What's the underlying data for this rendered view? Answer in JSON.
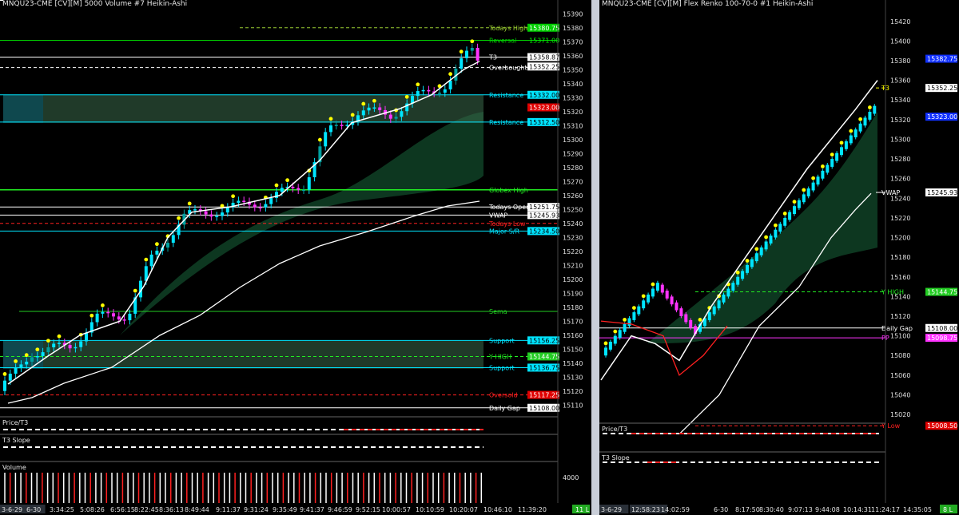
{
  "left": {
    "title": "MNQU23-CME [CV][M]  5000 Volume #7 Heikin-Ashi",
    "yticks": [
      15390,
      15380,
      15370,
      15360,
      15350,
      15340,
      15330,
      15320,
      15310,
      15300,
      15290,
      15280,
      15270,
      15260,
      15250,
      15240,
      15230,
      15220,
      15210,
      15200,
      15190,
      15180,
      15170,
      15160,
      15150,
      15140,
      15130,
      15120,
      15110
    ],
    "ylim": [
      15105,
      15393
    ],
    "levels": [
      {
        "label": "Todays High",
        "value": 15380,
        "color": "#9acd32",
        "box": "15380.75",
        "box_bg": "#00cc00",
        "box_fg": "#ffffff",
        "dash": true
      },
      {
        "label": "Reversal",
        "value": 15371,
        "color": "#00d000",
        "box": "15371.00",
        "box_bg": "",
        "box_fg": "#00ff00",
        "dash": false
      },
      {
        "label": "T3",
        "value": 15359,
        "color": "#ffffff",
        "box": "15358.875",
        "box_bg": "#ffffff",
        "box_fg": "#000000",
        "dash": false
      },
      {
        "label": "Overbought",
        "value": 15351.5,
        "color": "#ffffff",
        "box": "15351.50",
        "box_bg": "",
        "box_fg": "#ffffff",
        "dash": true
      },
      {
        "label": "",
        "value": 15352.25,
        "color": "#ffffff",
        "box": "15352.25",
        "box_bg": "#ffffff",
        "box_fg": "#000000",
        "dash": false
      },
      {
        "label": "Resistance",
        "value": 15332,
        "color": "#00e5ff",
        "box": "15332.00",
        "box_bg": "#00e5ff",
        "box_fg": "#000000",
        "dash": false
      },
      {
        "label": "",
        "value": 15323,
        "color": "#ff2020",
        "box": "15323.00",
        "box_bg": "#e00000",
        "box_fg": "#ffffff",
        "dash": false
      },
      {
        "label": "Resistance",
        "value": 15312.5,
        "color": "#00e5ff",
        "box": "15312.50",
        "box_bg": "#00e5ff",
        "box_fg": "#000000",
        "dash": false
      },
      {
        "label": "Globex High",
        "value": 15264,
        "color": "#22ee22",
        "box": "",
        "box_bg": "",
        "box_fg": "",
        "dash": false
      },
      {
        "label": "Todays Open",
        "value": 15251.75,
        "color": "#ffffff",
        "box": "15251.75",
        "box_bg": "#ffffff",
        "box_fg": "#000000",
        "dash": false
      },
      {
        "label": "VWAP",
        "value": 15245.93,
        "color": "#ffffff",
        "box": "15245.93",
        "box_bg": "#ffffff",
        "box_fg": "#000000",
        "dash": false
      },
      {
        "label": "Todays Low",
        "value": 15240,
        "color": "#ff2020",
        "box": "",
        "box_bg": "",
        "box_fg": "",
        "dash": true
      },
      {
        "label": "Major S/R",
        "value": 15234.5,
        "color": "#00e5ff",
        "box": "15234.50",
        "box_bg": "#00e5ff",
        "box_fg": "#000000",
        "dash": false
      },
      {
        "label": "Sema",
        "value": 15177,
        "color": "#22cc22",
        "box": "",
        "box_bg": "",
        "box_fg": "",
        "dash": false
      },
      {
        "label": "Support",
        "value": 15156.25,
        "color": "#00e5ff",
        "box": "15156.25",
        "box_bg": "#00e5ff",
        "box_fg": "#000000",
        "dash": false
      },
      {
        "label": "Y HIGH",
        "value": 15144.75,
        "color": "#22ee22",
        "box": "15144.75",
        "box_bg": "#22cc22",
        "box_fg": "#ffffff",
        "dash": true
      },
      {
        "label": "Support",
        "value": 15136.75,
        "color": "#00e5ff",
        "box": "15136.75",
        "box_bg": "#00e5ff",
        "box_fg": "#000000",
        "dash": false
      },
      {
        "label": "Oversold",
        "value": 15117.25,
        "color": "#ff2020",
        "box": "15117.25",
        "box_bg": "#e00000",
        "box_fg": "#ffffff",
        "dash": true
      },
      {
        "label": "Daily Gap",
        "value": 15108,
        "color": "#ffffff",
        "box": "15108.00",
        "box_bg": "#ffffff",
        "box_fg": "#000000",
        "dash": false
      }
    ],
    "xticks": [
      "3-6-29",
      "6-30",
      "3:34:25",
      "5:08:26",
      "6:56:15",
      "8:22:45",
      "8:36:13",
      "8:49:44",
      "9:11:37",
      "9:31:24",
      "9:35:49",
      "9:41:37",
      "9:46:59",
      "9:52:15",
      "10:00:57",
      "10:10:59",
      "10:20:07",
      "10:46:10",
      "11:39:20"
    ],
    "sub1": "Price/T3",
    "sub2": "T3 Slope",
    "sub3": "Volume",
    "vol_label": "4000",
    "corner": "11 L"
  },
  "right": {
    "title": "MNQU23-CME [CV][M]  Flex Renko 100-70-0 #1 Heikin-Ashi",
    "yticks": [
      15420,
      15400,
      15380,
      15360,
      15340,
      15320,
      15300,
      15280,
      15260,
      15240,
      15220,
      15200,
      15180,
      15160,
      15140,
      15120,
      15100,
      15080,
      15060,
      15040,
      15020
    ],
    "ylim": [
      15016,
      15432
    ],
    "levels": [
      {
        "label": "",
        "value": 15382,
        "color": "#2255ff",
        "box": "15382.75",
        "box_bg": "#1030ff",
        "box_fg": "#ffffff",
        "dash": false
      },
      {
        "label": "T3",
        "value": 15352.25,
        "color": "#ffff00",
        "box": "15352.25",
        "box_bg": "#ffffff",
        "box_fg": "#000000",
        "dash": true
      },
      {
        "label": "",
        "value": 15323,
        "color": "#2255ff",
        "box": "15323.00",
        "box_bg": "#1030ff",
        "box_fg": "#ffffff",
        "dash": false
      },
      {
        "label": "VWAP",
        "value": 15245.93,
        "color": "#ffffff",
        "box": "15245.93",
        "box_bg": "#ffffff",
        "box_fg": "#000000",
        "dash": false
      },
      {
        "label": "Y HIGH",
        "value": 15144.75,
        "color": "#22ee22",
        "box": "15144.75",
        "box_bg": "#22cc22",
        "box_fg": "#ffffff",
        "dash": true
      },
      {
        "label": "Daily Gap",
        "value": 15108,
        "color": "#ffffff",
        "box": "15108.00",
        "box_bg": "#ffffff",
        "box_fg": "#000000",
        "dash": false
      },
      {
        "label": "PP",
        "value": 15098,
        "color": "#ff33ff",
        "box": "15098.75",
        "box_bg": "#ff33ff",
        "box_fg": "#ffffff",
        "dash": false
      },
      {
        "label": "Y Low",
        "value": 15008.5,
        "color": "#ff2020",
        "box": "15008.50",
        "box_bg": "#e00000",
        "box_fg": "#ffffff",
        "dash": true
      }
    ],
    "xticks": [
      "3-6-29",
      "12:58:23",
      "14:02:59",
      "6-30",
      "8:17:50",
      "8:30:40",
      "9:07:13",
      "9:44:08",
      "10:14:31",
      "11:24:17",
      "14:35:05"
    ],
    "sub1": "Price/T3",
    "sub2": "T3 Slope",
    "corner": "8 L"
  },
  "colors": {
    "bull": "#00e5ff",
    "bull_dim": "#00a0a0",
    "bear": "#ff33ff",
    "dot": "#ffff00",
    "cloud": "#0e3a22",
    "zone": "#3a6a4a"
  }
}
